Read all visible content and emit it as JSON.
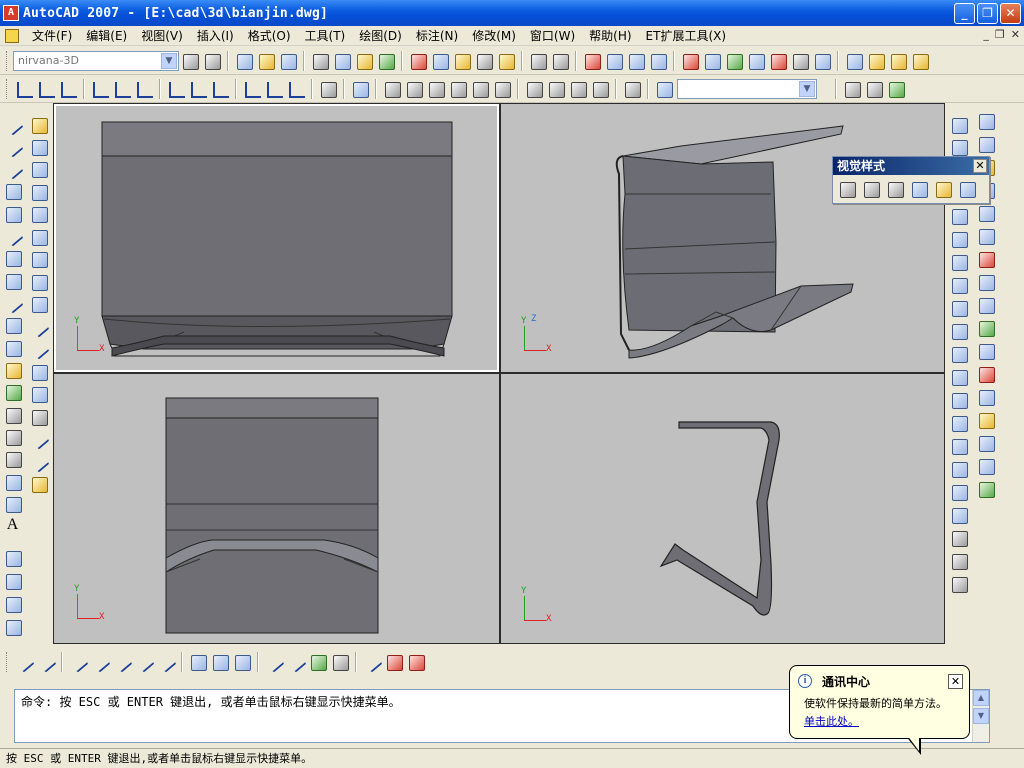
{
  "window": {
    "app_icon_text": "A",
    "title": "AutoCAD 2007 - [E:\\cad\\3d\\bianjin.dwg]",
    "minimize": "_",
    "restore": "❐",
    "close": "✕"
  },
  "menu": {
    "items": [
      "文件(F)",
      "编辑(E)",
      "视图(V)",
      "插入(I)",
      "格式(O)",
      "工具(T)",
      "绘图(D)",
      "标注(N)",
      "修改(M)",
      "窗口(W)",
      "帮助(H)",
      "ET扩展工具(X)"
    ],
    "doc_controls": [
      "_",
      "❐",
      "✕"
    ]
  },
  "workspace_combo": {
    "value": "nirvana-3D"
  },
  "view_combo": {
    "value": ""
  },
  "visual_style_toolbar": {
    "title": "视觉样式",
    "close": "✕"
  },
  "viewports": {
    "top_left": {
      "ucs": {
        "x": "X",
        "y": "Y"
      }
    },
    "top_right": {
      "ucs": {
        "x": "X",
        "y": "Y",
        "z": "Z"
      }
    },
    "bottom_left": {
      "ucs": {
        "x": "X",
        "y": "Y"
      }
    },
    "bottom_right": {
      "ucs": {
        "x": "X",
        "y": "Y"
      }
    }
  },
  "command_line": {
    "text": "命令: 按 ESC 或 ENTER 键退出, 或者单击鼠标右键显示快捷菜单。",
    "scroll_up": "▲",
    "scroll_down": "▼"
  },
  "status_bar": {
    "text": "按 ESC 或 ENTER 键退出,或者单击鼠标右键显示快捷菜单。"
  },
  "notification": {
    "icon": "i",
    "title": "通讯中心",
    "body": "使软件保持最新的简单方法。",
    "link": "单击此处。",
    "close": "✕"
  },
  "left_toolbar": {
    "text_icon": "A"
  }
}
